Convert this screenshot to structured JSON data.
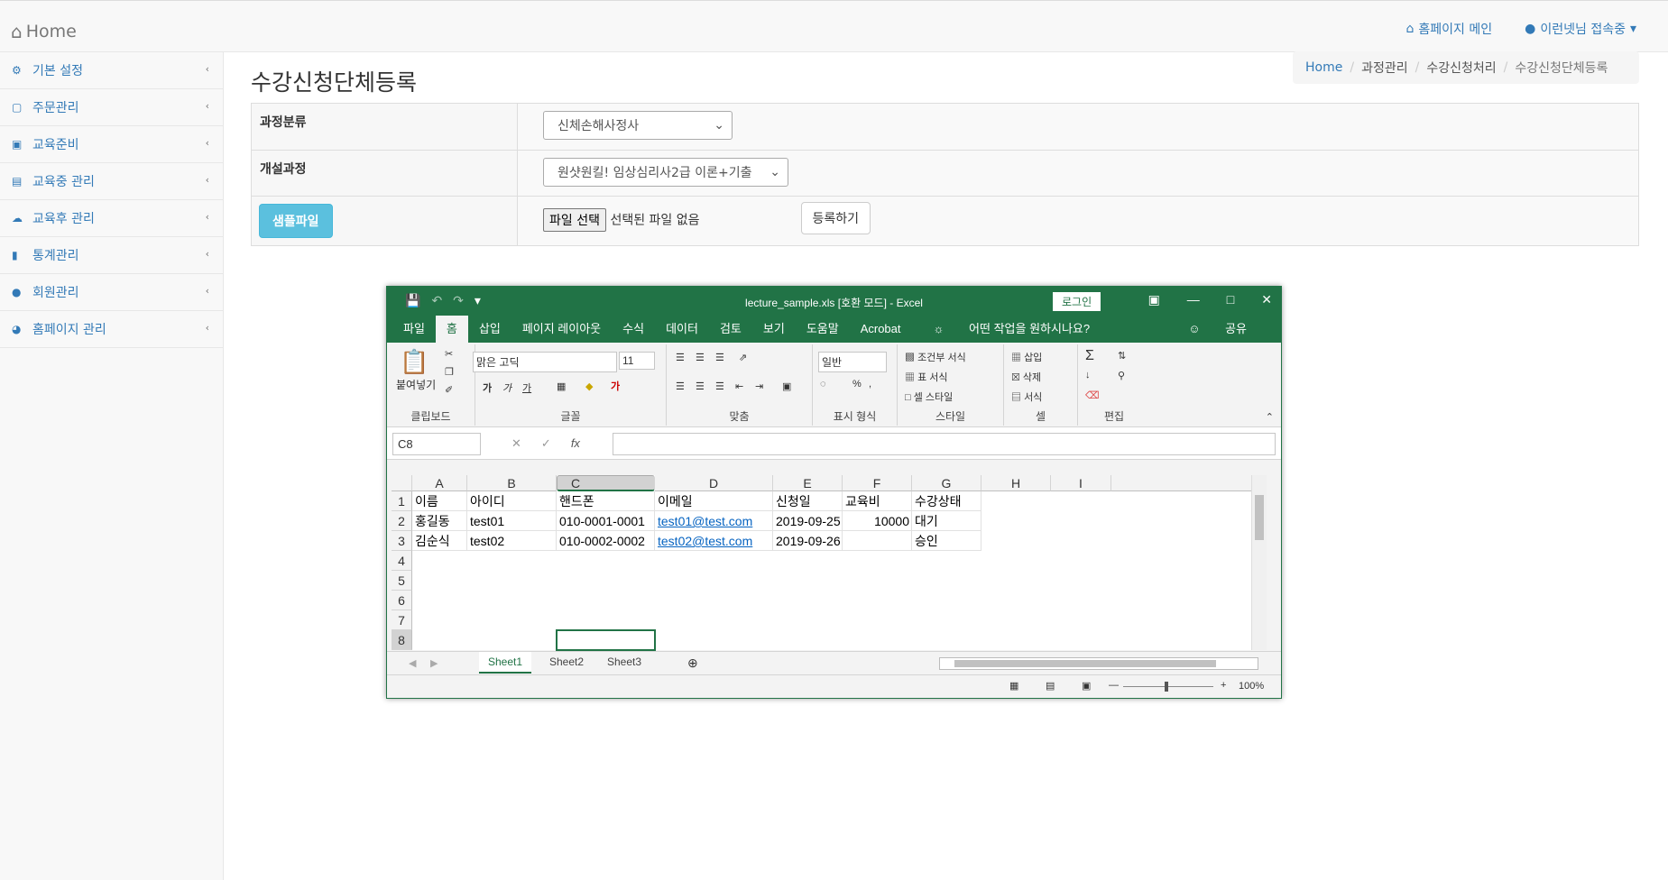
{
  "nav": {
    "brand": "Home",
    "homepage_link": "홈페이지 메인",
    "user_menu": "이런넷님 접속중"
  },
  "sidebar": {
    "items": [
      {
        "label": "기본 설정",
        "icon": "cogs-icon"
      },
      {
        "label": "주문관리",
        "icon": "cart-icon"
      },
      {
        "label": "교육준비",
        "icon": "laptop-icon"
      },
      {
        "label": "교육중 관리",
        "icon": "folder-open-icon"
      },
      {
        "label": "교육후 관리",
        "icon": "cloud-upload-icon"
      },
      {
        "label": "통계관리",
        "icon": "bar-chart-icon"
      },
      {
        "label": "회원관리",
        "icon": "user-icon"
      },
      {
        "label": "홈페이지 관리",
        "icon": "dashboard-icon"
      }
    ]
  },
  "page": {
    "title": "수강신청단체등록"
  },
  "breadcrumb": [
    "Home",
    "과정관리",
    "수강신청처리",
    "수강신청단체등록"
  ],
  "form": {
    "category_label": "과정분류",
    "category_value": "신체손해사정사",
    "course_label": "개설과정",
    "course_value": "원샷원킬! 임상심리사2급 이론+기출",
    "sample_button": "샘플파일",
    "file_button": "파일 선택",
    "file_status": "선택된 파일 없음",
    "register_button": "등록하기"
  },
  "excel": {
    "title": "lecture_sample.xls  [호환 모드]  -  Excel",
    "login": "로그인",
    "tabs": [
      "파일",
      "홈",
      "삽입",
      "페이지 레이아웃",
      "수식",
      "데이터",
      "검토",
      "보기",
      "도움말",
      "Acrobat"
    ],
    "tell_me": "어떤 작업을 원하시나요?",
    "share": "공유",
    "ribbon": {
      "paste": "붙여넣기",
      "clipboard": "클립보드",
      "font_name": "맑은 고딕",
      "font_size": "11",
      "font": "글꼴",
      "alignment": "맞춤",
      "number_format": "일반",
      "number": "표시 형식",
      "cond_format": "조건부 서식",
      "table_format": "표 서식",
      "cell_style": "셀 스타일",
      "styles": "스타일",
      "insert": "삽입",
      "delete": "삭제",
      "format": "서식",
      "cells": "셀",
      "editing": "편집"
    },
    "name_box": "C8",
    "columns": [
      "A",
      "B",
      "C",
      "D",
      "E",
      "F",
      "G",
      "H",
      "I"
    ],
    "rows": [
      "1",
      "2",
      "3",
      "4",
      "5",
      "6",
      "7",
      "8"
    ],
    "data": [
      [
        "이름",
        "아이디",
        "핸드폰",
        "이메일",
        "신청일",
        "교육비",
        "수강상태"
      ],
      [
        "홍길동",
        "test01",
        "010-0001-0001",
        "test01@test.com",
        "2019-09-25",
        "10000",
        "대기"
      ],
      [
        "김순식",
        "test02",
        "010-0002-0002",
        "test02@test.com",
        "2019-09-26",
        "",
        "승인"
      ]
    ],
    "sheets": [
      "Sheet1",
      "Sheet2",
      "Sheet3"
    ],
    "zoom": "100%"
  }
}
